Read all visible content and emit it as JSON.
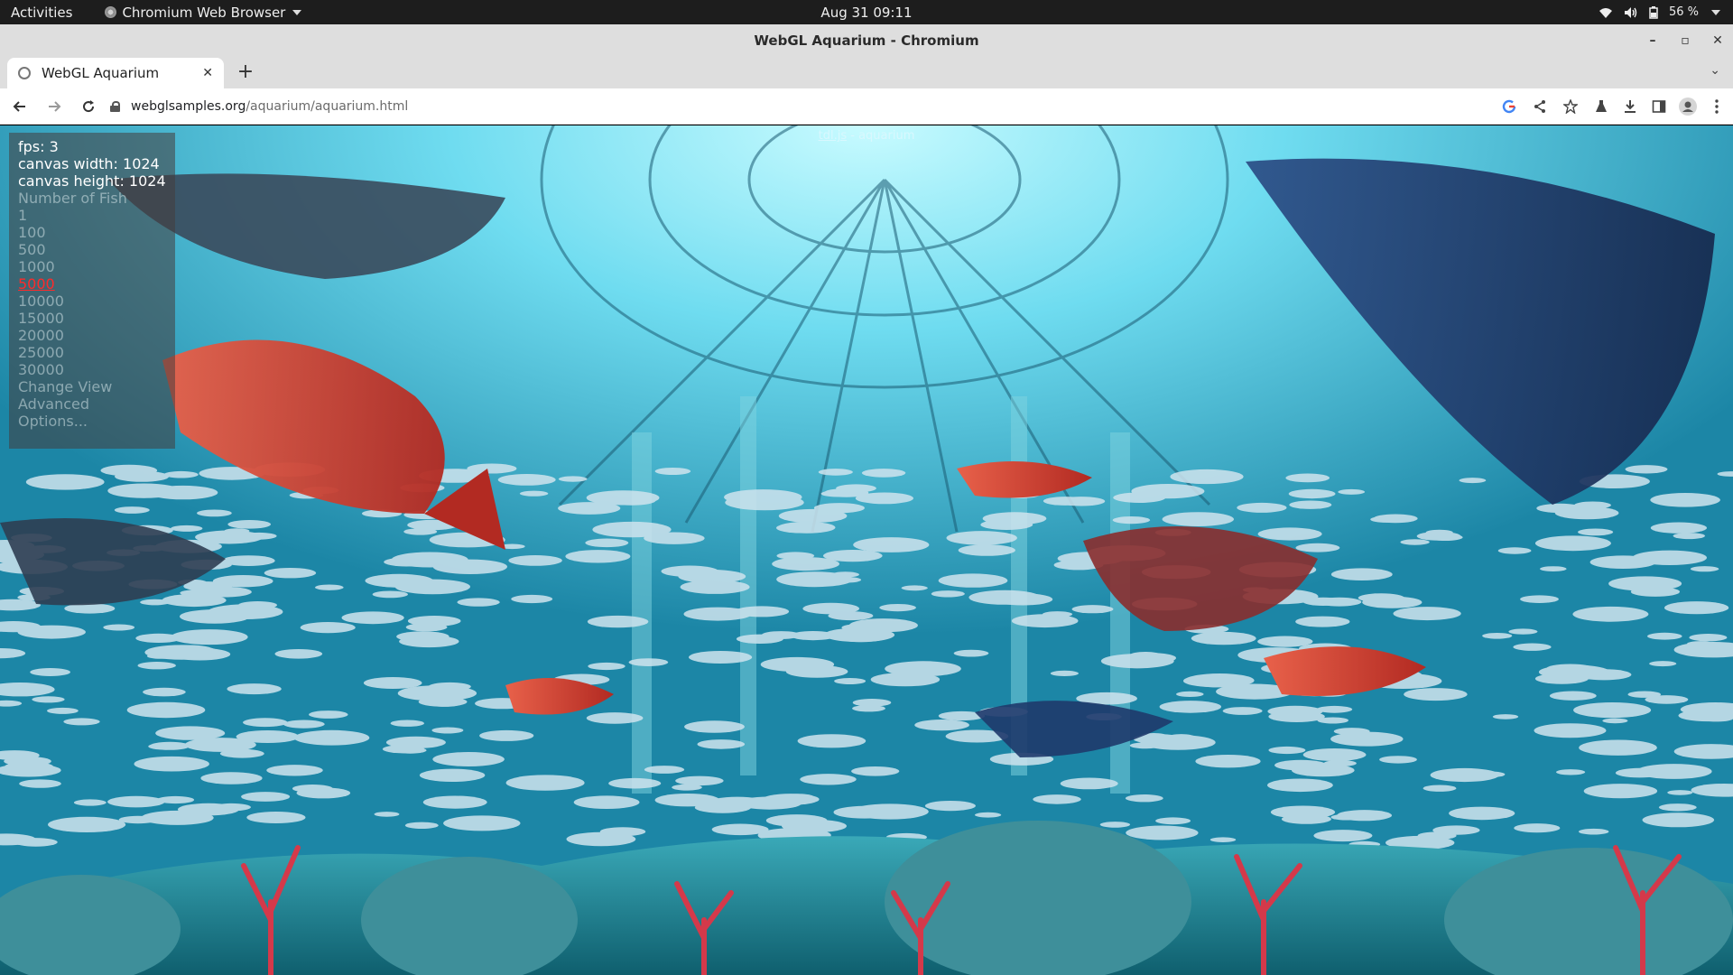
{
  "system_bar": {
    "activities": "Activities",
    "app_name": "Chromium Web Browser",
    "clock": "Aug 31  09:11",
    "battery": "56 %"
  },
  "window": {
    "title": "WebGL Aquarium - Chromium"
  },
  "tabs": [
    {
      "label": "WebGL Aquarium",
      "active": true
    }
  ],
  "toolbar": {
    "url_host": "webglsamples.org",
    "url_path": "/aquarium/aquarium.html"
  },
  "page": {
    "watermark_link": "tdl.js",
    "watermark_rest": " - aquarium",
    "hud": {
      "fps": "fps: 3",
      "canvas_width": "canvas width: 1024",
      "canvas_height": "canvas height: 1024",
      "fish_heading": "Number of Fish",
      "fish_options": [
        "1",
        "100",
        "500",
        "1000",
        "5000",
        "10000",
        "15000",
        "20000",
        "25000",
        "30000"
      ],
      "selected_fish": "5000",
      "change_view": "Change View",
      "advanced": "Advanced",
      "options": "Options..."
    }
  },
  "colors": {
    "water_light": "#9ff0ff",
    "water_dark": "#177a98",
    "selected_option": "#ff2a2a"
  }
}
